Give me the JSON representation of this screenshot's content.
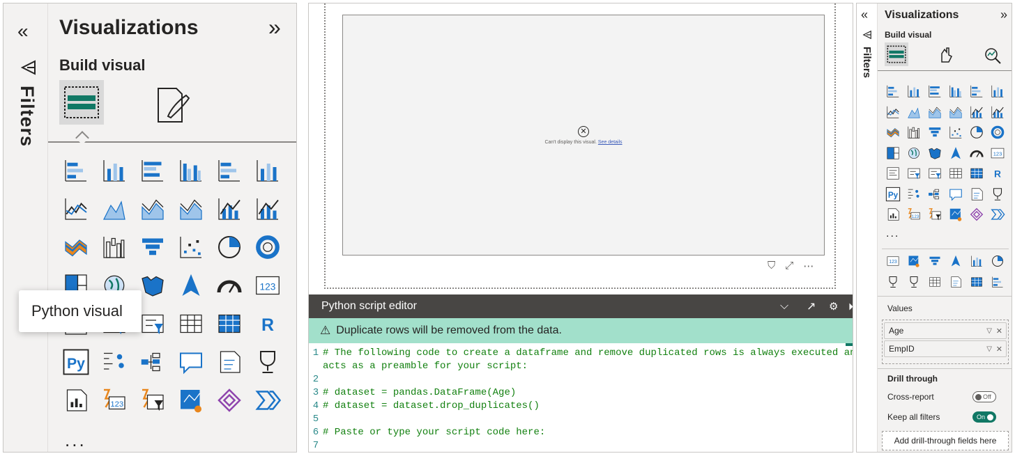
{
  "left_panel": {
    "filters_label": "Filters",
    "title": "Visualizations",
    "build_visual": "Build visual",
    "tooltip": "Python visual",
    "more": "..."
  },
  "canvas": {
    "error_text": "Can't display this visual.",
    "error_link": "See details"
  },
  "editor": {
    "title": "Python script editor",
    "warning": "Duplicate rows will be removed from the data.",
    "lines": [
      {
        "n": "1",
        "text": "# The following code to create a dataframe and remove duplicated rows is always executed and"
      },
      {
        "n": "",
        "text": "acts as a preamble for your script:"
      },
      {
        "n": "2",
        "text": ""
      },
      {
        "n": "3",
        "text": "# dataset = pandas.DataFrame(Age)"
      },
      {
        "n": "4",
        "text": "# dataset = dataset.drop_duplicates()"
      },
      {
        "n": "5",
        "text": ""
      },
      {
        "n": "6",
        "text": "# Paste or type your script code here:"
      },
      {
        "n": "7",
        "text": ""
      }
    ]
  },
  "right_panel": {
    "filters_label": "Filters",
    "title": "Visualizations",
    "build_visual": "Build visual",
    "more": "...",
    "values_label": "Values",
    "fields": [
      "Age",
      "EmpID"
    ],
    "drill_through": "Drill through",
    "cross_report": "Cross-report",
    "cross_report_state": "Off",
    "keep_all_filters": "Keep all filters",
    "keep_all_filters_state": "On",
    "add_drill": "Add drill-through fields here"
  },
  "colors": {
    "accent": "#117865",
    "warning_bg": "#a2e0cb",
    "editor_head": "#484644",
    "blue": "#1a73c8"
  }
}
